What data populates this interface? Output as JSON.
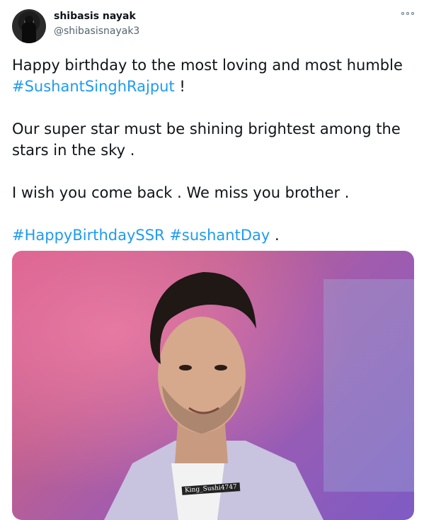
{
  "tweet": {
    "author_name": "shibasis nayak",
    "author_handle": "@shibasisnayak3",
    "line1_text": "Happy birthday to the most loving and most humble ",
    "line1_tag": "#SushantSinghRajput",
    "line1_end": " !",
    "para2": "Our super star must be shining brightest among the stars in the sky .",
    "para3": "I wish you come back . We miss you brother .",
    "tag1": "#HappyBirthdaySSR",
    "tag_space": " ",
    "tag2": "#sushantDay",
    "tags_end": " .",
    "image_watermark": "King_Sushi4747"
  },
  "icons": {
    "more": "more-options-icon",
    "avatar": "profile-avatar"
  },
  "colors": {
    "link": "#1d9bf0",
    "text": "#0f1419",
    "secondary": "#536471"
  }
}
